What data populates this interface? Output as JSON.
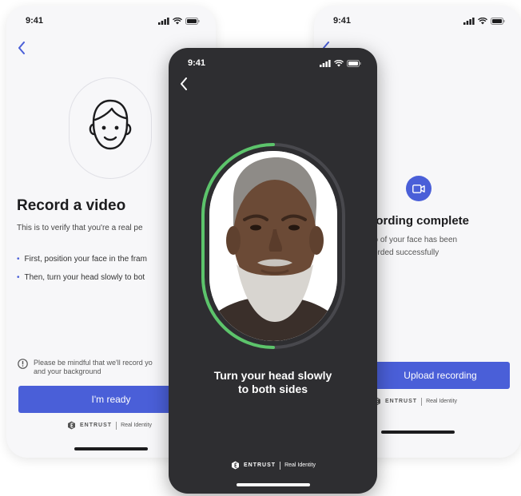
{
  "left_screen": {
    "time": "9:41",
    "title": "Record a video",
    "subtitle": "This is to verify that you're a real pe",
    "bullets": [
      "First, position your face in the fram",
      "Then, turn your head slowly to bot"
    ],
    "notice_line1": "Please be mindful that we'll record yo",
    "notice_line2": "and your background",
    "ready_button": "I'm ready",
    "brand_name": "ENTRUST",
    "brand_product": "Real Identity"
  },
  "center_screen": {
    "time": "9:41",
    "instruction_line1": "Turn your head slowly",
    "instruction_line2": "to both sides",
    "brand_name": "ENTRUST",
    "brand_product": "Real Identity"
  },
  "right_screen": {
    "time": "9:41",
    "title": "cording complete",
    "description_line1": "eo of your face has been",
    "description_line2": "corded successfully",
    "upload_button": "Upload recording",
    "brand_name": "ENTRUST",
    "brand_product": "Real Identity"
  },
  "colors": {
    "accent": "#4a5fd8",
    "progress": "#5cc46b",
    "dark_bg": "#2e2e31",
    "light_bg": "#f7f7f9"
  },
  "icons": {
    "signal": "cellular-signal-icon",
    "wifi": "wifi-icon",
    "battery": "battery-icon",
    "back": "chevron-left-icon",
    "face": "face-outline-icon",
    "info": "info-icon",
    "camera": "video-camera-icon",
    "logo": "entrust-logo-icon"
  }
}
